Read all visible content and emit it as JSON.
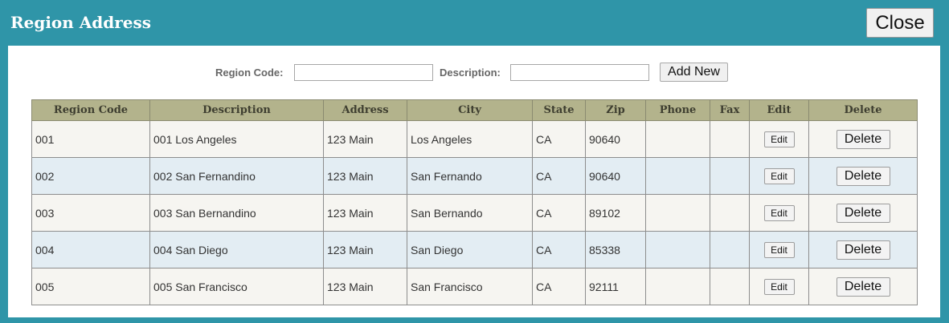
{
  "dialog": {
    "title": "Region Address",
    "close_label": "Close"
  },
  "filter": {
    "region_code_label": "Region Code:",
    "region_code_value": "",
    "description_label": "Description:",
    "description_value": "",
    "add_new_label": "Add New"
  },
  "table": {
    "headers": [
      "Region Code",
      "Description",
      "Address",
      "City",
      "State",
      "Zip",
      "Phone",
      "Fax",
      "Edit",
      "Delete"
    ],
    "edit_label": "Edit",
    "delete_label": "Delete",
    "rows": [
      {
        "region_code": "001",
        "description": "001 Los Angeles",
        "address": "123 Main",
        "city": "Los Angeles",
        "state": "CA",
        "zip": "90640",
        "phone": "",
        "fax": ""
      },
      {
        "region_code": "002",
        "description": "002 San Fernandino",
        "address": "123 Main",
        "city": "San Fernando",
        "state": "CA",
        "zip": "90640",
        "phone": "",
        "fax": ""
      },
      {
        "region_code": "003",
        "description": "003 San Bernandino",
        "address": "123 Main",
        "city": "San Bernando",
        "state": "CA",
        "zip": "89102",
        "phone": "",
        "fax": ""
      },
      {
        "region_code": "004",
        "description": "004 San Diego",
        "address": "123 Main",
        "city": "San Diego",
        "state": "CA",
        "zip": "85338",
        "phone": "",
        "fax": ""
      },
      {
        "region_code": "005",
        "description": "005 San Francisco",
        "address": "123 Main",
        "city": "San Francisco",
        "state": "CA",
        "zip": "92111",
        "phone": "",
        "fax": ""
      }
    ]
  },
  "colors": {
    "frame": "#2f95a8",
    "header": "#b3b38c",
    "row_odd": "#f6f5f1",
    "row_even": "#e3edf3"
  }
}
